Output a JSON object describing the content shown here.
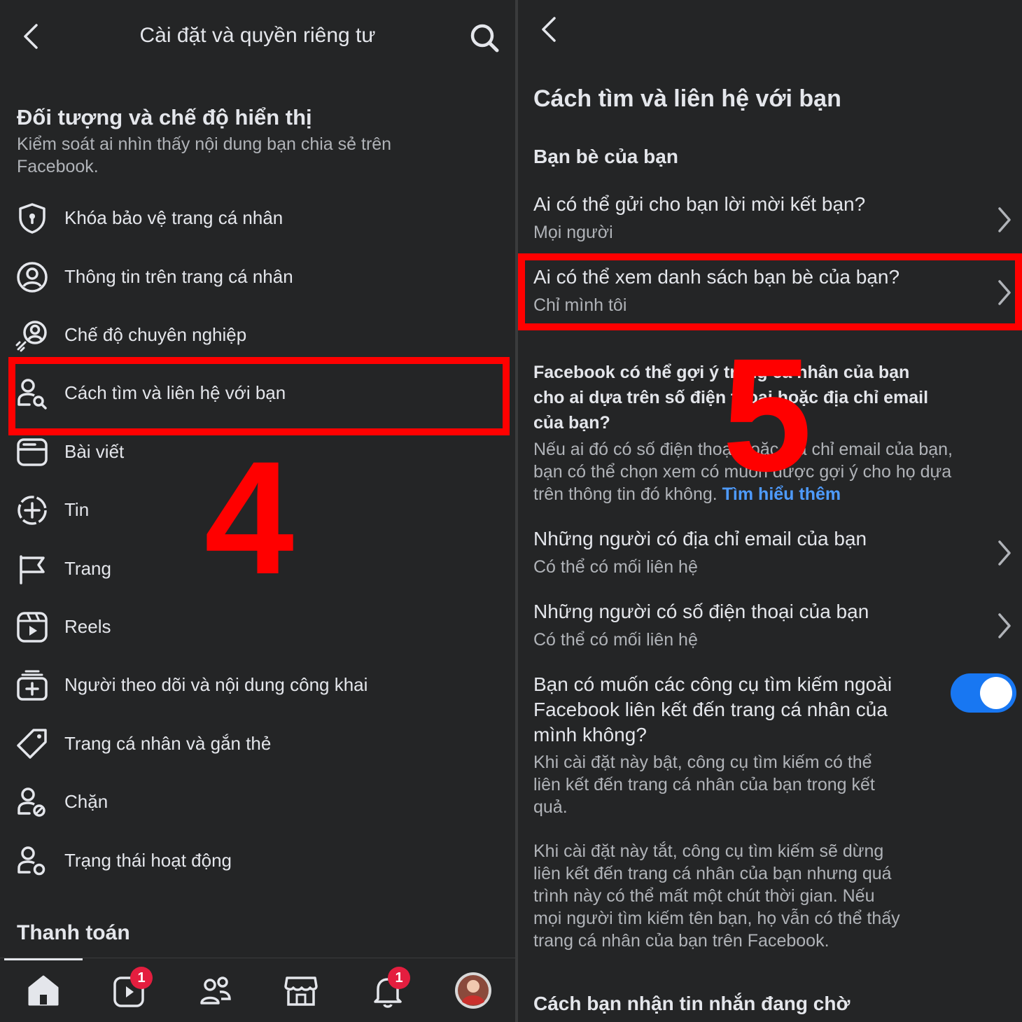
{
  "left": {
    "header_title": "Cài đặt và quyền riêng tư",
    "section_title": "Đối tượng và chế độ hiển thị",
    "section_desc_line1": "Kiểm soát ai nhìn thấy nội dung bạn chia sẻ trên",
    "section_desc_line2": "Facebook.",
    "menu_items": [
      {
        "label": "Khóa bảo vệ trang cá nhân",
        "icon": "shield-icon"
      },
      {
        "label": "Thông tin trên trang cá nhân",
        "icon": "profile-circle-icon"
      },
      {
        "label": "Chế độ chuyên nghiệp",
        "icon": "professional-mode-icon"
      },
      {
        "label": "Cách tìm và liên hệ với bạn",
        "icon": "find-contact-icon"
      },
      {
        "label": "Bài viết",
        "icon": "posts-icon"
      },
      {
        "label": "Tin",
        "icon": "stories-plus-icon"
      },
      {
        "label": "Trang",
        "icon": "flag-icon"
      },
      {
        "label": "Reels",
        "icon": "reels-icon"
      },
      {
        "label": "Người theo dõi và nội dung công khai",
        "icon": "followers-box-icon"
      },
      {
        "label": "Trang cá nhân và gắn thẻ",
        "icon": "tag-icon"
      },
      {
        "label": "Chặn",
        "icon": "block-user-icon"
      },
      {
        "label": "Trạng thái hoạt động",
        "icon": "active-status-icon"
      }
    ],
    "payment_title": "Thanh toán",
    "annotation_number": "4",
    "nav": {
      "video_badge": "1",
      "notifications_badge": "1"
    }
  },
  "right": {
    "page_title": "Cách tìm và liên hệ với bạn",
    "friends_section": "Bạn bè của bạn",
    "q1": "Ai có thể gửi cho bạn lời mời kết bạn?",
    "q1_value": "Mọi người",
    "q2": "Ai có thể xem danh sách bạn bè của bạn?",
    "q2_value": "Chỉ mình tôi",
    "lookup_title_line1": "Facebook có thể gợi ý trang cá nhân của bạn",
    "lookup_title_line2": "cho ai dựa trên số điện thoại hoặc địa chỉ email",
    "lookup_title_line3": "của bạn?",
    "lookup_desc_line1": "Nếu ai đó có số điện thoại hoặc địa chỉ email của bạn,",
    "lookup_desc_line2": "bạn có thể chọn xem có muốn được gợi ý cho họ dựa",
    "lookup_desc_line3": "trên thông tin đó không.",
    "learn_more": "Tìm hiểu thêm",
    "email_q": "Những người có địa chỉ email của bạn",
    "email_value": "Có thể có mối liên hệ",
    "phone_q": "Những người có số điện thoại của bạn",
    "phone_value": "Có thể có mối liên hệ",
    "search_q_line1": "Bạn có muốn các công cụ tìm kiếm ngoài",
    "search_q_line2": "Facebook liên kết đến trang cá nhân của",
    "search_q_line3": "mình không?",
    "search_on_line1": "Khi cài đặt này bật, công cụ tìm kiếm có thể",
    "search_on_line2": "liên kết đến trang cá nhân của bạn trong kết",
    "search_on_line3": "quả.",
    "search_off_line1": "Khi cài đặt này tắt, công cụ tìm kiếm sẽ dừng",
    "search_off_line2": "liên kết đến trang cá nhân của bạn nhưng quá",
    "search_off_line3": "trình này có thể mất một chút thời gian. Nếu",
    "search_off_line4": "mọi người tìm kiếm tên bạn, họ vẫn có thể thấy",
    "search_off_line5": "trang cá nhân của bạn trên Facebook.",
    "pending_title": "Cách bạn nhận tin nhắn đang chờ",
    "toggle_on": true,
    "annotation_number": "5"
  },
  "colors": {
    "background": "#242526",
    "highlight": "#ff0000",
    "toggle": "#1877f2",
    "link": "#4e9bff"
  }
}
